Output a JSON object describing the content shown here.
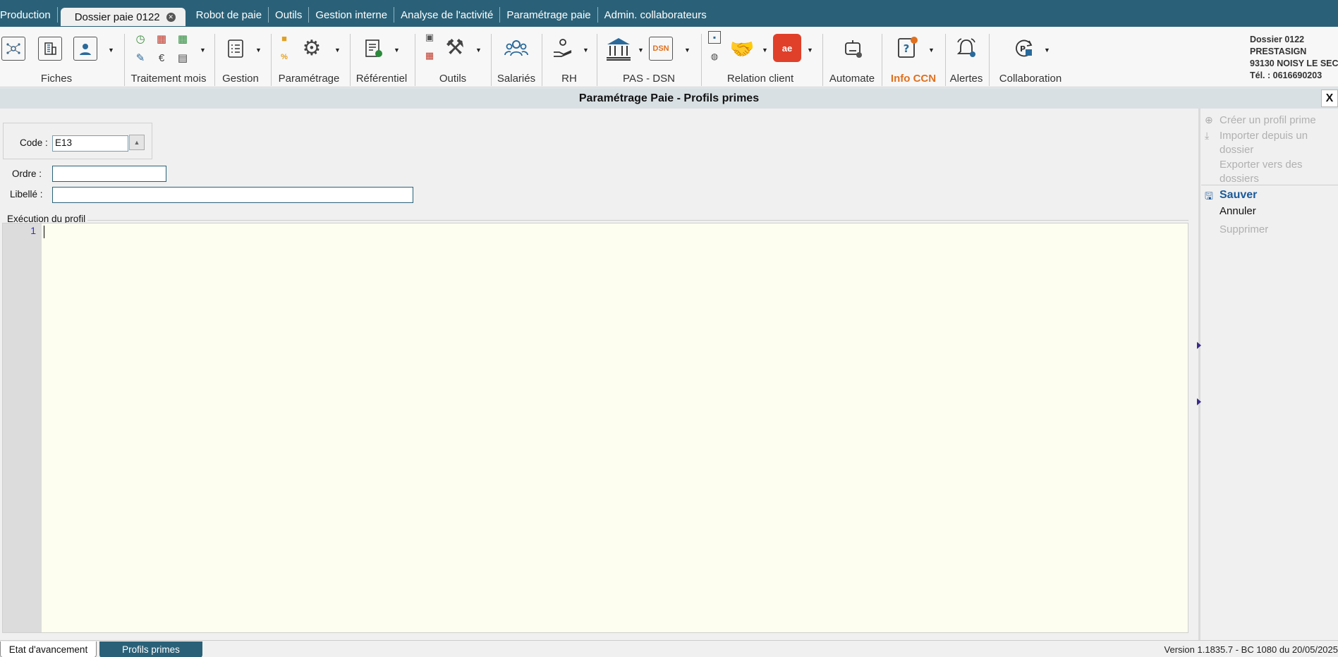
{
  "tabs": [
    {
      "label": "Production"
    },
    {
      "label": "Dossier paie 0122",
      "active": true
    },
    {
      "label": "Robot de paie"
    },
    {
      "label": "Outils"
    },
    {
      "label": "Gestion interne"
    },
    {
      "label": "Analyse de l'activité"
    },
    {
      "label": "Paramétrage paie"
    },
    {
      "label": "Admin. collaborateurs"
    }
  ],
  "ribbon": {
    "groups": [
      "Fiches",
      "Traitement mois",
      "Gestion",
      "Paramétrage",
      "Référentiel",
      "Outils",
      "Salariés",
      "RH",
      "PAS - DSN",
      "Relation client",
      "Automate",
      "Info CCN",
      "Alertes",
      "Collaboration"
    ],
    "dossier": {
      "line1": "Dossier 0122",
      "line2": "PRESTASIGN",
      "line3": "93130 NOISY LE SEC",
      "line4": "Tél. : 0616690203"
    }
  },
  "titlebar": {
    "title": "Paramétrage Paie - Profils primes",
    "close": "X"
  },
  "form": {
    "code_label": "Code :",
    "code_value": "E13",
    "ordre_label": "Ordre :",
    "ordre_value": "",
    "libelle_label": "Libellé :",
    "libelle_value": "",
    "exec_label": "Exécution du profil",
    "line_number": "1"
  },
  "side": {
    "create": "Créer un profil prime",
    "import1": "Importer depuis un",
    "import2": "dossier",
    "export1": "Exporter vers des",
    "export2": "dossiers",
    "save": "Sauver",
    "cancel": "Annuler",
    "delete": "Supprimer"
  },
  "bottom": {
    "tab1": "Etat d'avancement",
    "tab2": "Profils primes",
    "version": "Version 1.1835.7 - BC 1080 du 20/05/2025"
  },
  "colors": {
    "brand": "#2a6178",
    "accent_ccn": "#e0701e",
    "save": "#1a5a9a"
  }
}
